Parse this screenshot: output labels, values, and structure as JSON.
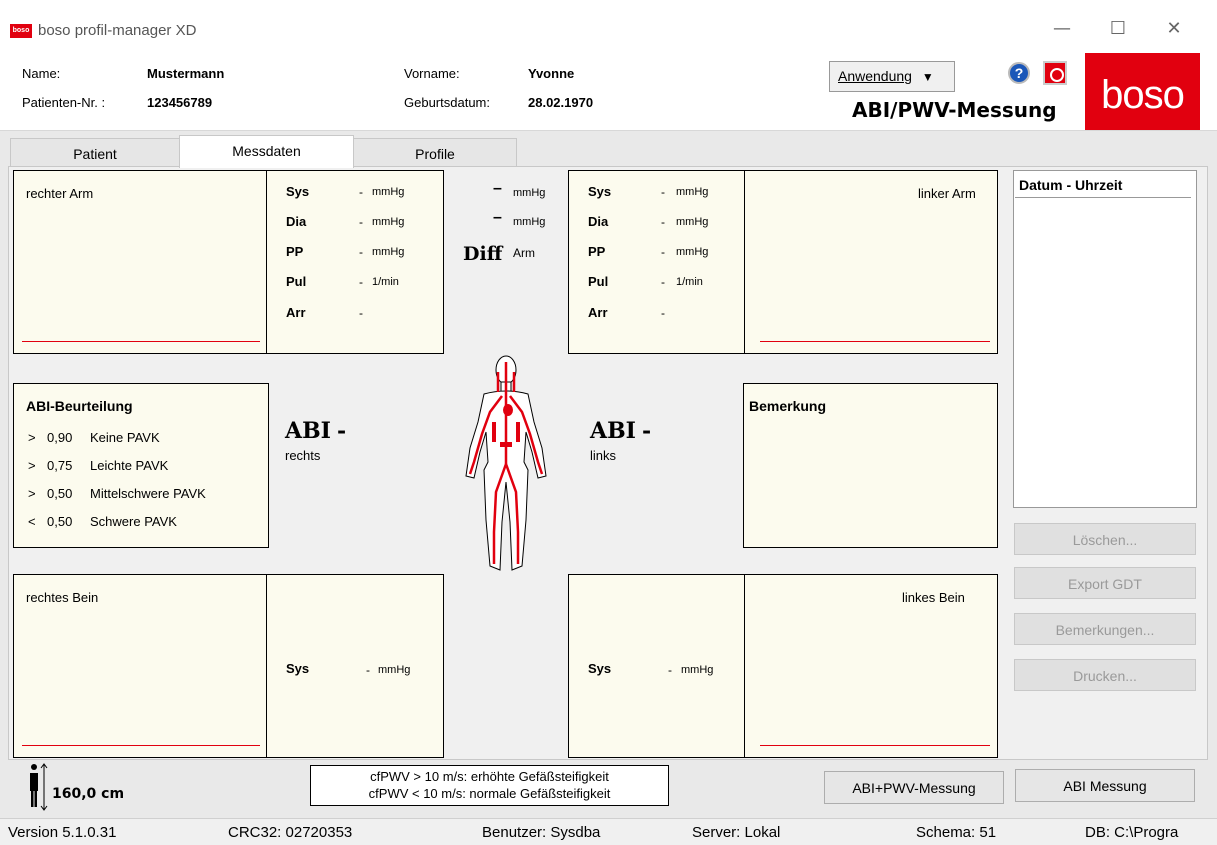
{
  "window": {
    "title": "boso profil-manager XD",
    "logo_text": "boso",
    "minimize": "—",
    "maximize": "☐",
    "close": "✕"
  },
  "header": {
    "name_label": "Name:",
    "name_value": "Mustermann",
    "patnr_label": "Patienten-Nr. :",
    "patnr_value": "123456789",
    "vorname_label": "Vorname:",
    "vorname_value": "Yvonne",
    "geb_label": "Geburtsdatum:",
    "geb_value": "28.02.1970",
    "anwendung_label": "Anwendung",
    "help_label": "?",
    "brand": "boso",
    "mode_title": "ABI/PWV-Messung"
  },
  "tabs": [
    "Patient",
    "Messdaten",
    "Profile"
  ],
  "right_arm": {
    "title": "rechter Arm",
    "rows": [
      {
        "label": "Sys",
        "value": "-",
        "unit": "mmHg"
      },
      {
        "label": "Dia",
        "value": "-",
        "unit": "mmHg"
      },
      {
        "label": "PP",
        "value": "-",
        "unit": "mmHg"
      },
      {
        "label": "Pul",
        "value": "-",
        "unit": "1/min"
      },
      {
        "label": "Arr",
        "value": "-",
        "unit": ""
      }
    ]
  },
  "left_arm": {
    "title": "linker Arm",
    "rows": [
      {
        "label": "Sys",
        "value": "-",
        "unit": "mmHg"
      },
      {
        "label": "Dia",
        "value": "-",
        "unit": "mmHg"
      },
      {
        "label": "PP",
        "value": "-",
        "unit": "mmHg"
      },
      {
        "label": "Pul",
        "value": "-",
        "unit": "1/min"
      },
      {
        "label": "Arr",
        "value": "-",
        "unit": ""
      }
    ]
  },
  "diff": {
    "row1_value": "–",
    "row1_unit": "mmHg",
    "row2_value": "–",
    "row2_unit": "mmHg",
    "label": "Diff",
    "sub": "Arm"
  },
  "abi_rating": {
    "title": "ABI-Beurteilung",
    "rows": [
      {
        "op": ">",
        "value": "0,90",
        "text": "Keine PAVK"
      },
      {
        "op": ">",
        "value": "0,75",
        "text": "Leichte PAVK"
      },
      {
        "op": ">",
        "value": "0,50",
        "text": "Mittelschwere PAVK"
      },
      {
        "op": "<",
        "value": "0,50",
        "text": "Schwere PAVK"
      }
    ]
  },
  "abi_right": {
    "label": "ABI",
    "value": "-",
    "side": "rechts"
  },
  "abi_left": {
    "label": "ABI",
    "value": "-",
    "side": "links"
  },
  "remark": {
    "title": "Bemerkung"
  },
  "right_leg": {
    "title": "rechtes Bein",
    "label": "Sys",
    "value": "-",
    "unit": "mmHg"
  },
  "left_leg": {
    "title": "linkes Bein",
    "label": "Sys",
    "value": "-",
    "unit": "mmHg"
  },
  "date_list": {
    "header": "Datum - Uhrzeit"
  },
  "side_buttons": {
    "delete": "Löschen...",
    "export": "Export GDT",
    "remarks": "Bemerkungen...",
    "print": "Drucken..."
  },
  "height": {
    "value": "160,0 cm"
  },
  "pwv_info": {
    "line1": "cfPWV > 10 m/s: erhöhte Gefäßsteifigkeit",
    "line2": "cfPWV < 10 m/s: normale Gefäßsteifigkeit"
  },
  "bottom_buttons": {
    "abi_pwv": "ABI+PWV-Messung",
    "abi": "ABI Messung"
  },
  "statusbar": {
    "version": "Version 5.1.0.31",
    "crc": "CRC32: 02720353",
    "user": "Benutzer: Sysdba",
    "server": "Server: Lokal",
    "schema": "Schema: 51",
    "db": "DB: C:\\Progra"
  },
  "colors": {
    "brand_red": "#e1000f",
    "panel_bg": "#fcfbee"
  }
}
